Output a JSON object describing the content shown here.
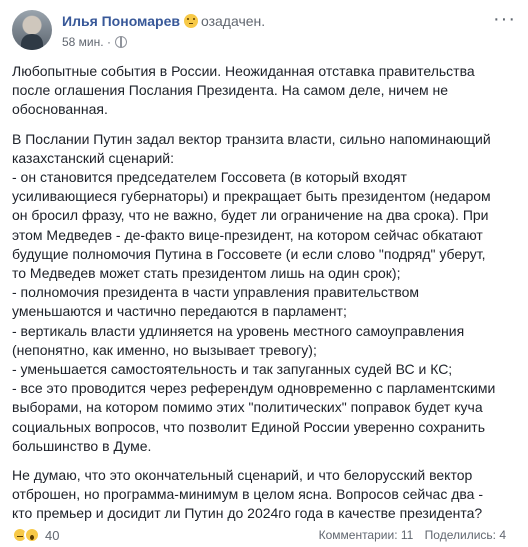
{
  "post": {
    "author": "Илья Пономарев",
    "feeling": "озадачен.",
    "time": "58 мин.",
    "dot": "·",
    "more_icon": "more-dots-icon",
    "paragraphs": [
      "Любопытные события в России. Неожиданная отставка правительства\nпосле оглашения Послания Президента. На самом деле, ничем не\nобоснованная.",
      "В Послании Путин задал вектор транзита власти, сильно напоминающий\nказахстанский сценарий:\n- он становится председателем Госсовета (в который входят\nусиливающиеся губернаторы) и прекращает быть президентом (недаром\nон бросил фразу, что не важно, будет ли ограничение на два срока). При\nэтом Медведев - де-факто вице-президент, на котором сейчас обкатают\nбудущие полномочия Путина в Госсовете (и если слово \"подряд\" уберут,\nто Медведев может стать президентом лишь на один срок);\n- полномочия президента в части управления правительством\nуменьшаются и частично передаются в парламент;\n- вертикаль власти удлиняется на уровень местного самоуправления\n(непонятно, как именно, но вызывает тревогу);\n- уменьшается самостоятельность и так запуганных судей ВС и КС;\n- все это проводится через референдум одновременно с парламентскими\nвыборами, на котором помимо этих \"политических\" поправок будет куча\nсоциальных вопросов, что позволит Единой России уверенно сохранить\nбольшинство в Думе.",
      "Не думаю, что это окончательный сценарий, и что белорусский вектор\nотброшен, но программа-минимум в целом ясна. Вопросов сейчас два -\nкто премьер и досидит ли Путин до 2024го года в качестве президента?"
    ]
  },
  "footer": {
    "reaction_count": "40",
    "comments": "Комментарии: 11",
    "shares": "Поделились: 4"
  },
  "colors": {
    "author": "#385898",
    "text": "#1d2129",
    "meta": "#616770"
  }
}
